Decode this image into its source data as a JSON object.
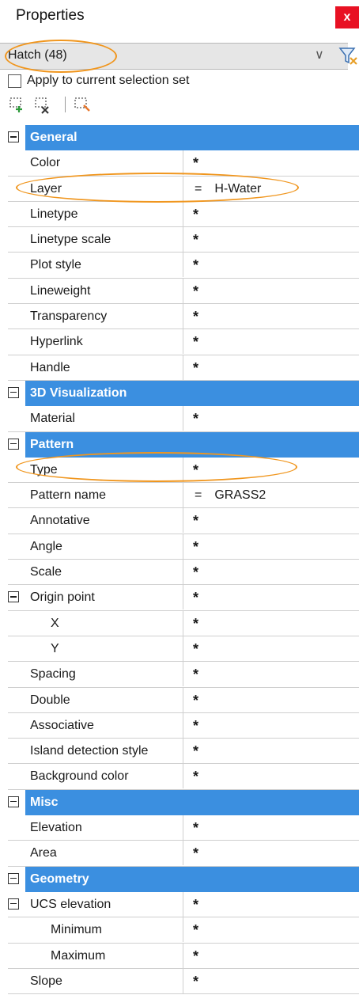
{
  "window": {
    "title": "Properties",
    "close_label": "x"
  },
  "selector": {
    "value": "Hatch (48)",
    "chevron": "chevron-down-icon"
  },
  "apply": {
    "label": "Apply to current selection set"
  },
  "toolbar": {
    "icons": [
      "add-to-selection-icon",
      "remove-from-selection-icon",
      "select-objects-icon"
    ]
  },
  "accent": "#3b8fe0",
  "highlight": "#f0961e",
  "grid": {
    "general": {
      "label": "General",
      "rows": [
        {
          "name": "Color",
          "value": "*"
        },
        {
          "name": "Layer",
          "eq": "=",
          "value": "H-Water"
        },
        {
          "name": "Linetype",
          "value": "*"
        },
        {
          "name": "Linetype scale",
          "value": "*"
        },
        {
          "name": "Plot style",
          "value": "*"
        },
        {
          "name": "Lineweight",
          "value": "*"
        },
        {
          "name": "Transparency",
          "value": "*"
        },
        {
          "name": "Hyperlink",
          "value": "*"
        },
        {
          "name": "Handle",
          "value": "*"
        }
      ]
    },
    "viz3d": {
      "label": "3D Visualization",
      "rows": [
        {
          "name": "Material",
          "value": "*"
        }
      ]
    },
    "pattern": {
      "label": "Pattern",
      "rows": [
        {
          "name": "Type",
          "value": "*"
        },
        {
          "name": "Pattern name",
          "eq": "=",
          "value": "GRASS2"
        },
        {
          "name": "Annotative",
          "value": "*"
        },
        {
          "name": "Angle",
          "value": "*"
        },
        {
          "name": "Scale",
          "value": "*"
        },
        {
          "name": "Origin point",
          "value": "*"
        },
        {
          "name": "X",
          "value": "*"
        },
        {
          "name": "Y",
          "value": "*"
        },
        {
          "name": "Spacing",
          "value": "*"
        },
        {
          "name": "Double",
          "value": "*"
        },
        {
          "name": "Associative",
          "value": "*"
        },
        {
          "name": "Island detection style",
          "value": "*"
        },
        {
          "name": "Background color",
          "value": "*"
        }
      ]
    },
    "misc": {
      "label": "Misc",
      "rows": [
        {
          "name": "Elevation",
          "value": "*"
        },
        {
          "name": "Area",
          "value": "*"
        }
      ]
    },
    "geometry": {
      "label": "Geometry",
      "rows": [
        {
          "name": "UCS elevation",
          "value": "*"
        },
        {
          "name": "Minimum",
          "value": "*"
        },
        {
          "name": "Maximum",
          "value": "*"
        },
        {
          "name": "Slope",
          "value": "*"
        }
      ]
    }
  }
}
